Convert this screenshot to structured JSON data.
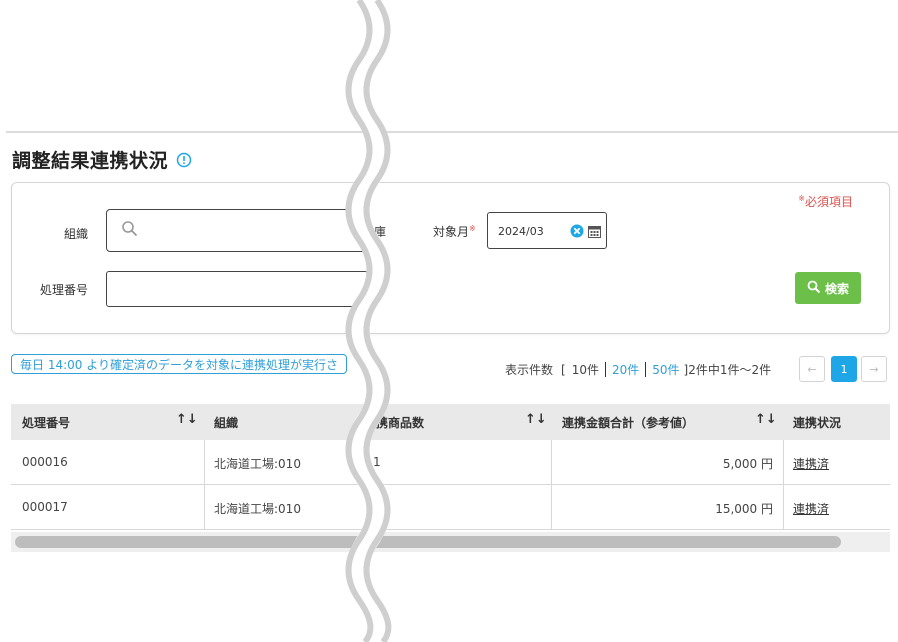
{
  "page": {
    "title": "調整結果連携状況"
  },
  "search": {
    "required_note": "必須項目",
    "required_mark": "※",
    "org_label": "組織",
    "process_label": "処理番号",
    "warehouse_label_fragment": "庫",
    "month_label": "対象月",
    "month_value": "2024/03",
    "search_button": "検索"
  },
  "notice": {
    "text": "毎日 14:00 より確定済のデータを対象に連携処理が実行さ"
  },
  "pager": {
    "display_label": "表示件数",
    "bracket_open": "[",
    "bracket_close": "]",
    "sizes": [
      "10件",
      "20件",
      "50件"
    ],
    "summary": "2件中1件〜2件",
    "current_page": "1",
    "prev": "←",
    "next": "→"
  },
  "table": {
    "headers": {
      "process_no": "処理番号",
      "org": "組織",
      "item_count": "携商品数",
      "amount": "連携金額合計（参考値）",
      "status": "連携状況"
    },
    "sort_icon": "↑↓",
    "rows": [
      {
        "process_no": "000016",
        "org": "北海道工場:010",
        "item_count": "1",
        "amount": "5,000 円",
        "status": "連携済"
      },
      {
        "process_no": "000017",
        "org": "北海道工場:010",
        "item_count": "",
        "amount": "15,000 円",
        "status": "連携済"
      }
    ]
  },
  "colors": {
    "accent": "#1fa6e6",
    "search_button": "#6cc04a",
    "required": "#d9534f",
    "notice": "#2f9fd8"
  }
}
